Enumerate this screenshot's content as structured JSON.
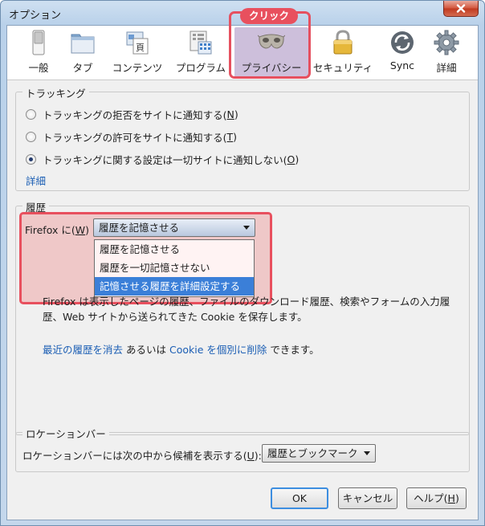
{
  "window": {
    "title": "オプション"
  },
  "toolbar": {
    "items": [
      {
        "label": "一般",
        "icon": "switch-icon"
      },
      {
        "label": "タブ",
        "icon": "tabs-window-icon"
      },
      {
        "label": "コンテンツ",
        "icon": "content-page-icon"
      },
      {
        "label": "プログラム",
        "icon": "programs-grid-icon"
      },
      {
        "label": "プライバシー",
        "icon": "privacy-mask-icon",
        "selected": true
      },
      {
        "label": "セキュリティ",
        "icon": "padlock-icon"
      },
      {
        "label": "Sync",
        "icon": "sync-arrows-icon"
      },
      {
        "label": "詳細",
        "icon": "gear-icon"
      }
    ],
    "callout_label": "クリック"
  },
  "tracking": {
    "title": "トラッキング",
    "options": [
      {
        "label": "トラッキングの拒否をサイトに通知する(",
        "key": "N",
        "suffix": ")",
        "checked": false
      },
      {
        "label": "トラッキングの許可をサイトに通知する(",
        "key": "T",
        "suffix": ")",
        "checked": false
      },
      {
        "label": "トラッキングに関する設定は一切サイトに通知しない(",
        "key": "O",
        "suffix": ")",
        "checked": true
      }
    ],
    "details_link": "詳細"
  },
  "history": {
    "title": "履歴",
    "firefox_prefix": "Firefox に(",
    "firefox_key": "W",
    "firefox_suffix": ")",
    "selected": "履歴を記憶させる",
    "options": [
      "履歴を記憶させる",
      "履歴を一切記憶させない",
      "記憶させる履歴を詳細設定する"
    ],
    "description_line1": "Firefox は表示したページの履歴、ファイルのダウンロード履歴、検索やフォームの入力履",
    "description_line2": "歴、Web サイトから送られてきた Cookie を保存します。",
    "clear_link": "最近の履歴を消去",
    "connector": " あるいは ",
    "cookie_link": "Cookie を個別に削除",
    "tail": " できます。"
  },
  "location_bar": {
    "title": "ロケーションバー",
    "prompt_prefix": "ロケーションバーには次の中から候補を表示する(",
    "prompt_key": "U",
    "prompt_suffix": "):",
    "selected": "履歴とブックマーク"
  },
  "buttons": {
    "ok": "OK",
    "cancel": "キャンセル",
    "help_prefix": "ヘルプ(",
    "help_key": "H",
    "help_suffix": ")"
  },
  "colors": {
    "accent": "#e8505e",
    "link": "#1b5eb4",
    "selection": "#3b7fd8"
  }
}
